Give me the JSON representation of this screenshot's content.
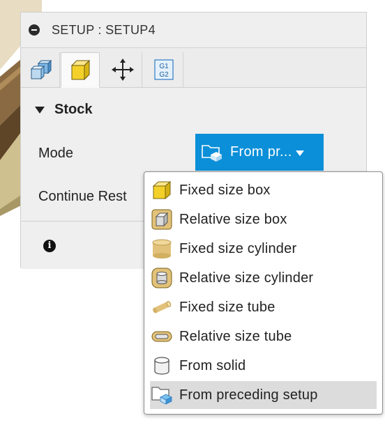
{
  "panel": {
    "title": "SETUP : SETUP4",
    "tabs": [
      {
        "name": "setup",
        "icon": "setup-cubes-icon"
      },
      {
        "name": "stock",
        "icon": "stock-box-icon",
        "active": true
      },
      {
        "name": "post-process",
        "icon": "move-arrows-icon"
      },
      {
        "name": "nc",
        "icon": "g1-g2-icon",
        "text_top": "G1",
        "text_bottom": "G2"
      }
    ],
    "section_title": "Stock",
    "mode_label": "Mode",
    "mode_value": "From pr...",
    "continue_label": "Continue Rest"
  },
  "menu": {
    "items": [
      {
        "label": "Fixed size box",
        "icon": "fixed-box-icon"
      },
      {
        "label": "Relative size box",
        "icon": "relative-box-icon"
      },
      {
        "label": "Fixed size cylinder",
        "icon": "fixed-cylinder-icon"
      },
      {
        "label": "Relative size cylinder",
        "icon": "relative-cylinder-icon"
      },
      {
        "label": "Fixed size tube",
        "icon": "fixed-tube-icon"
      },
      {
        "label": "Relative size tube",
        "icon": "relative-tube-icon"
      },
      {
        "label": "From solid",
        "icon": "solid-icon"
      },
      {
        "label": "From preceding setup",
        "icon": "preceding-setup-icon",
        "selected": true
      }
    ]
  },
  "colors": {
    "accent": "#0b8fd8",
    "yellow": "#f4d12a",
    "tan": "#e2c27a"
  }
}
